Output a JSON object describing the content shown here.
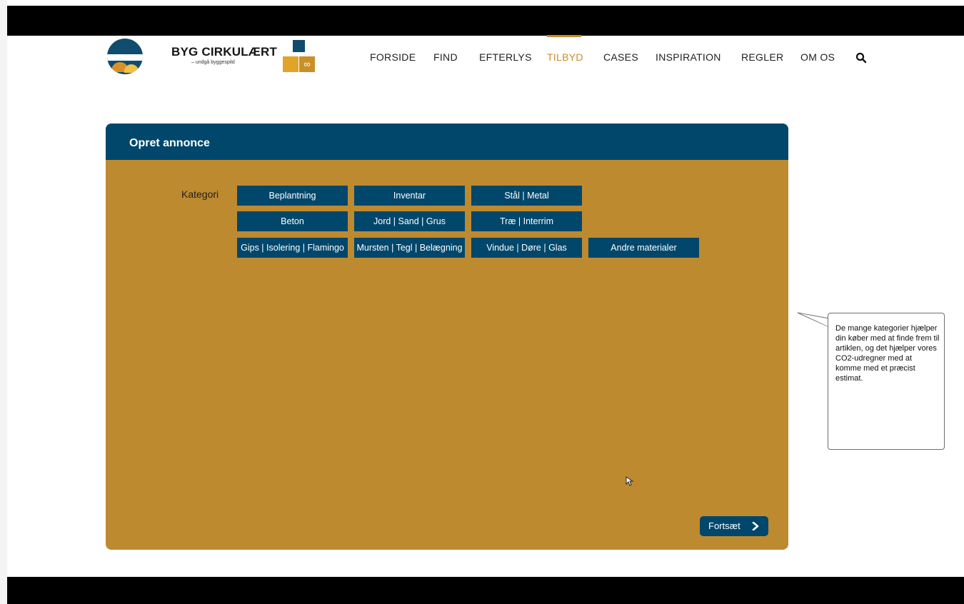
{
  "header": {
    "brand": "BYG CIRKULÆRT",
    "tagline": "– undgå byggespild",
    "nav": [
      {
        "label": "FORSIDE",
        "active": false
      },
      {
        "label": "FIND",
        "active": false
      },
      {
        "label": "EFTERLYS",
        "active": false
      },
      {
        "label": "TILBYD",
        "active": true
      },
      {
        "label": "CASES",
        "active": false
      },
      {
        "label": "INSPIRATION",
        "active": false
      },
      {
        "label": "REGLER",
        "active": false
      },
      {
        "label": "OM OS",
        "active": false
      }
    ],
    "search_icon": "search-icon"
  },
  "form": {
    "title": "Opret annonce",
    "category_label": "Kategori",
    "categories": [
      "Beplantning",
      "Inventar",
      "Stål | Metal",
      "Beton",
      "Jord | Sand | Grus",
      "Træ | Interrim",
      "Gips | Isolering | Flamingo",
      "Mursten | Tegl | Belægning",
      "Vindue | Døre | Glas",
      "Andre materialer"
    ],
    "continue_label": "Fortsæt"
  },
  "callout": {
    "text": "De mange kategorier hjælper din køber med at finde frem til artiklen, og det hjælper vores CO2-udregner med at komme med et præcist estimat."
  },
  "colors": {
    "primary": "#00476b",
    "panel": "#bd8a30",
    "accent": "#c78b2c"
  }
}
